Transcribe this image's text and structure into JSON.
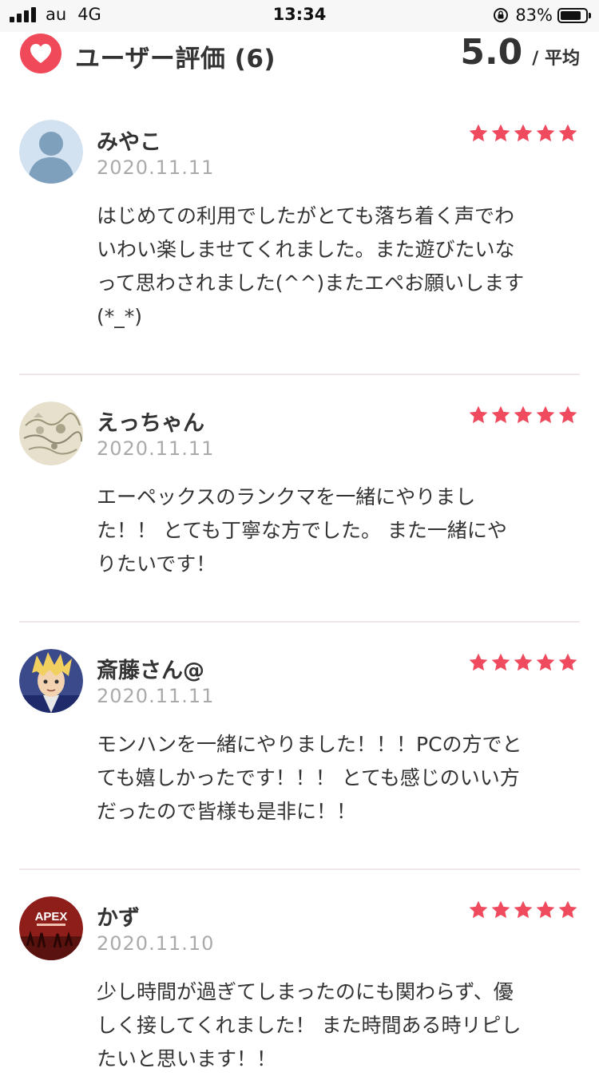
{
  "status_bar": {
    "carrier": "au",
    "network": "4G",
    "time": "13:34",
    "battery_text": "83%",
    "battery_level": 0.83
  },
  "header": {
    "title": "ユーザー評価 (6)",
    "average": "5.0",
    "average_label": "/ 平均",
    "accent_color": "#f04a5a"
  },
  "reviews": [
    {
      "name": "みやこ",
      "date": "2020.11.11",
      "rating": 5,
      "text": "はじめての利用でしたがとても落ち着く声でわ\nいわい楽しませてくれました。また遊びたいな\nって思わされました(^^)またエペお願いします\n(*_*)",
      "avatar": "default-user-icon"
    },
    {
      "name": "えっちゃん",
      "date": "2020.11.11",
      "rating": 5,
      "text": "エーペックスのランクマを一緒にやりまし\nた！！ とても丁寧な方でした。 また一緒にや\nりたいです！",
      "avatar": "sketch-map-image"
    },
    {
      "name": "斎藤さん@",
      "date": "2020.11.11",
      "rating": 5,
      "text": "モンハンを一緒にやりました！！！PCの方でと\nても嬉しかったです！！！ とても感じのいい方\nだったので皆様も是非に！！",
      "avatar": "anime-character-image"
    },
    {
      "name": "かず",
      "date": "2020.11.10",
      "rating": 5,
      "text": "少し時間が過ぎてしまったのにも関わらず、優\nしく接してくれました！ また時間ある時リピし\nたいと思います！！",
      "avatar": "apex-legends-logo",
      "avatar_text": "APEX"
    }
  ],
  "star_color": "#ef4a5e"
}
